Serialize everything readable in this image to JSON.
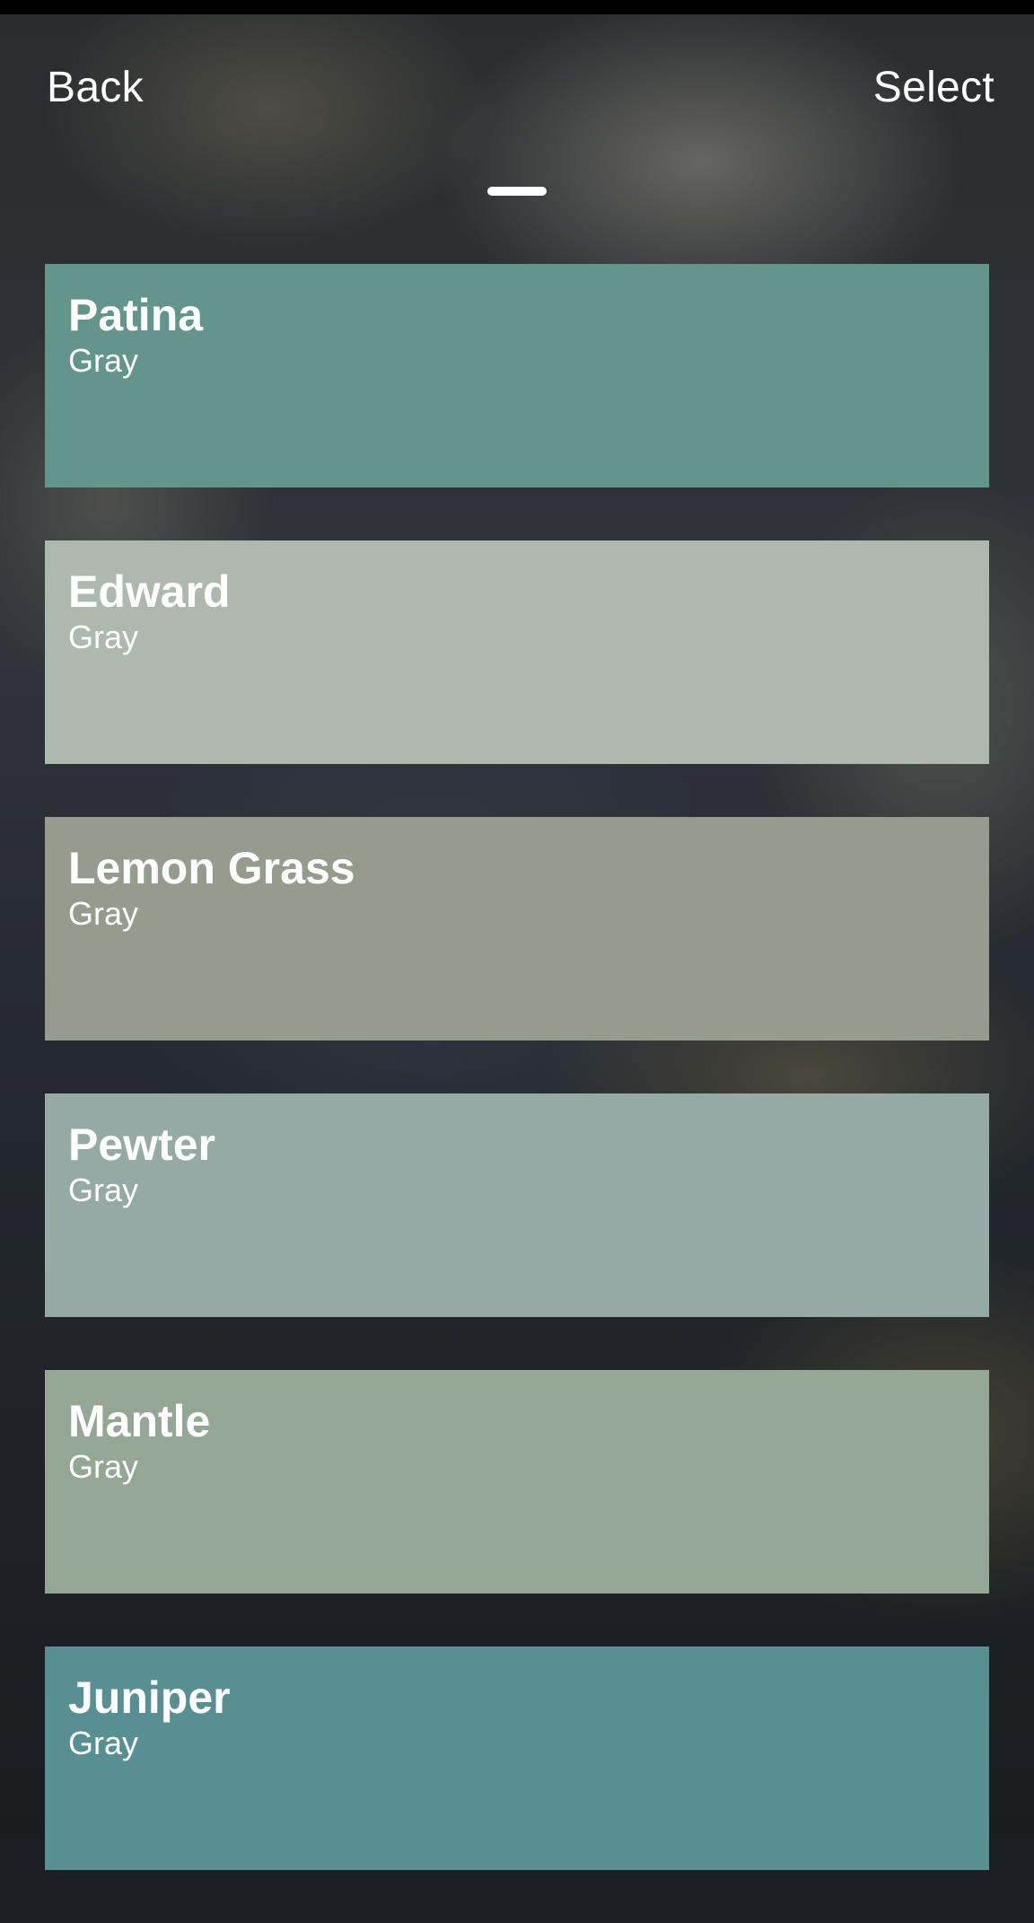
{
  "header": {
    "back_label": "Back",
    "select_label": "Select"
  },
  "swatches": [
    {
      "name": "Patina",
      "family": "Gray",
      "color": "#62958b"
    },
    {
      "name": "Edward",
      "family": "Gray",
      "color": "#adb9ae"
    },
    {
      "name": "Lemon Grass",
      "family": "Gray",
      "color": "#959c8e"
    },
    {
      "name": "Pewter",
      "family": "Gray",
      "color": "#95aaa5"
    },
    {
      "name": "Mantle",
      "family": "Gray",
      "color": "#94a694"
    },
    {
      "name": "Juniper",
      "family": "Gray",
      "color": "#578f93"
    }
  ]
}
